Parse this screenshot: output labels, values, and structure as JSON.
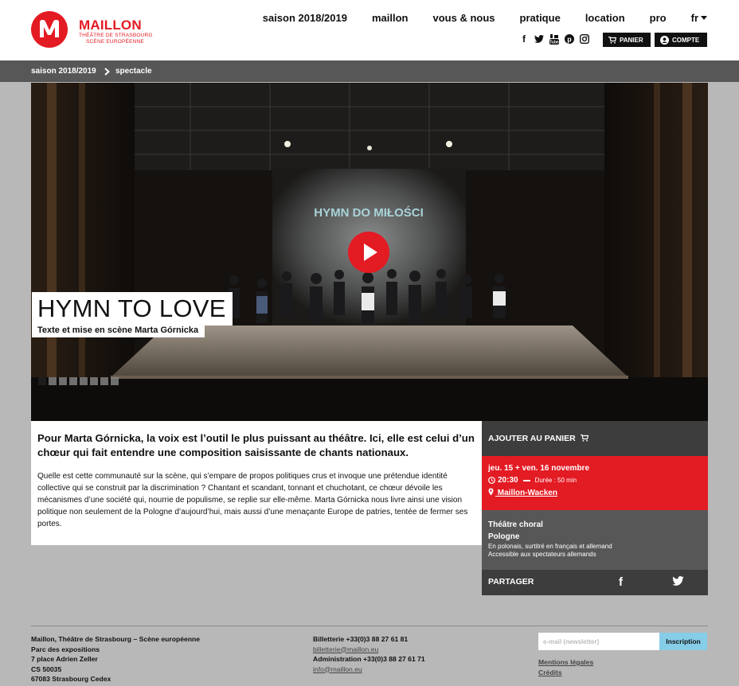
{
  "brand": {
    "name": "MAILLON",
    "sub1": "THÉÂTRE DE STRASBOURG",
    "sub2": "SCÈNE EUROPÉENNE",
    "color": "#e31b23"
  },
  "nav": {
    "items": [
      "saison 2018/2019",
      "maillon",
      "vous & nous",
      "pratique",
      "location",
      "pro"
    ],
    "lang": "fr"
  },
  "social": {
    "icons": [
      "facebook-icon",
      "twitter-icon",
      "youtube-icon",
      "pinterest-icon",
      "instagram-icon"
    ]
  },
  "header_buttons": {
    "cart": "PANIER",
    "account": "COMPTE"
  },
  "breadcrumb": [
    "saison 2018/2019",
    "spectacle"
  ],
  "hero": {
    "title": "HYMN TO LOVE",
    "subtitle": "Texte et mise en scène Marta Górnicka",
    "backdrop_text": "HYMN DO MIŁOŚCI",
    "slides": 8,
    "active_slide": 1
  },
  "main": {
    "lead": "Pour Marta Górnicka, la voix est l’outil le plus puissant au théâtre. Ici, elle est celui d’un chœur qui fait entendre une composition saisissante de chants nationaux.",
    "body": "Quelle est cette communauté sur la scène, qui s’empare de propos politiques crus et invoque une prétendue identité collective qui se construit par la discrimination ? Chantant et scandant, tonnant et chuchotant, ce chœur dévoile les mécanismes d’une société qui, nourrie de populisme, se replie sur elle-même. Marta Górnicka nous livre ainsi une vision politique non seulement de la Pologne d’aujourd’hui, mais aussi d’une menaçante Europe de patries, tentée de fermer ses portes."
  },
  "sidebar": {
    "add_to_cart": "AJOUTER AU PANIER",
    "dates": "jeu. 15 + ven. 16 novembre",
    "time": "20:30",
    "duration": "Durée : 50 min",
    "venue": "Maillon-Wacken",
    "genre": "Théâtre choral",
    "country": "Pologne",
    "language": "En polonais, surtitré en français et allemand",
    "accessibility": "Accessible aux spectateurs allemands",
    "share": "PARTAGER"
  },
  "footer": {
    "address": [
      "Maillon, Théâtre de Strasbourg – Scène européenne",
      "Parc des expositions",
      "7 place Adrien Zeller",
      "CS 50035",
      "67083 Strasbourg Cedex"
    ],
    "billetterie_label": "Billetterie +33(0)3 88 27 61 81",
    "billetterie_email": "billetterie@maillon.eu",
    "admin_label": "Administration +33(0)3 88 27 61 71",
    "admin_email": "info@maillon.eu",
    "newsletter_placeholder": "e-mail (newsletter)",
    "newsletter_button": "Inscription",
    "legal": "Mentions légales",
    "credits": "Crédits"
  }
}
